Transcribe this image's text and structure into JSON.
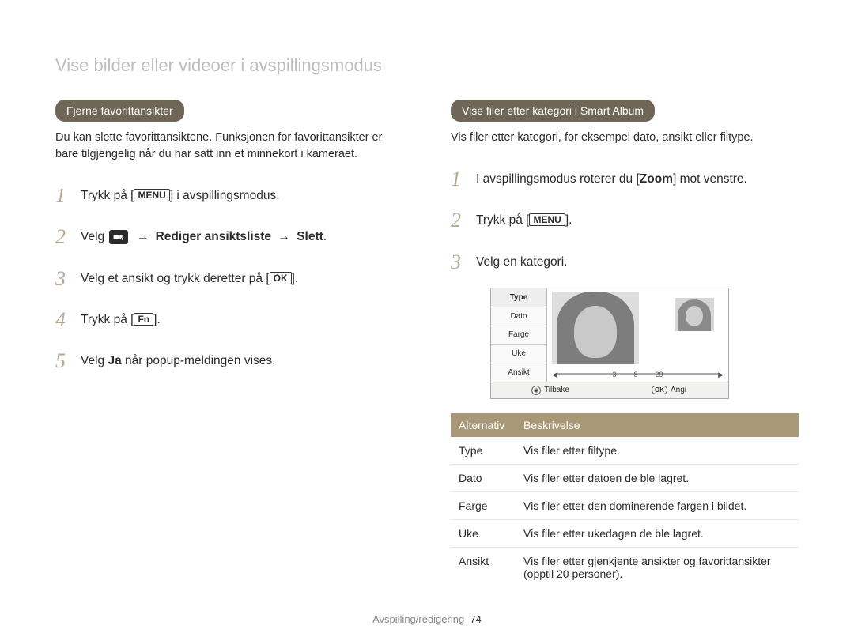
{
  "section_title": "Vise bilder eller videoer i avspillingsmodus",
  "left": {
    "heading": "Fjerne favorittansikter",
    "intro": "Du kan slette favorittansiktene. Funksjonen for favorittansikter er bare tilgjengelig når du har satt inn et minnekort i kameraet.",
    "steps": {
      "s1_a": "Trykk på [",
      "s1_btn": "MENU",
      "s1_b": "] i avspillingsmodus.",
      "s2_a": "Velg ",
      "s2_arrow": "→",
      "s2_b1": "Rediger ansiktsliste",
      "s2_b2": "Slett",
      "s3_a": "Velg et ansikt og trykk deretter på [",
      "s3_btn": "OK",
      "s3_b": "].",
      "s4_a": "Trykk på [",
      "s4_btn": "Fn",
      "s4_b": "].",
      "s5_a": "Velg ",
      "s5_bold": "Ja",
      "s5_b": " når popup-meldingen vises."
    }
  },
  "right": {
    "heading": "Vise filer etter kategori i Smart Album",
    "intro": "Vis filer etter kategori, for eksempel dato, ansikt eller filtype.",
    "steps": {
      "s1_a": "I avspillingsmodus roterer du [",
      "s1_bold": "Zoom",
      "s1_b": "] mot venstre.",
      "s2_a": "Trykk på [",
      "s2_btn": "MENU",
      "s2_b": "].",
      "s3": "Velg en kategori."
    },
    "cam": {
      "menu": [
        "Type",
        "Dato",
        "Farge",
        "Uke",
        "Ansikt"
      ],
      "scroll_labels": [
        "3",
        "8",
        "29"
      ],
      "footer_back": "Tilbake",
      "footer_ok": "OK",
      "footer_set": "Angi"
    },
    "table": {
      "h1": "Alternativ",
      "h2": "Beskrivelse",
      "rows": [
        {
          "k": "Type",
          "v": "Vis filer etter filtype."
        },
        {
          "k": "Dato",
          "v": "Vis filer etter datoen de ble lagret."
        },
        {
          "k": "Farge",
          "v": "Vis filer etter den dominerende fargen i bildet."
        },
        {
          "k": "Uke",
          "v": "Vis filer etter ukedagen de ble lagret."
        },
        {
          "k": "Ansikt",
          "v": "Vis filer etter gjenkjente ansikter og favorittansikter (opptil 20 personer)."
        }
      ]
    }
  },
  "footer": {
    "section": "Avspilling/redigering",
    "page": "74"
  }
}
